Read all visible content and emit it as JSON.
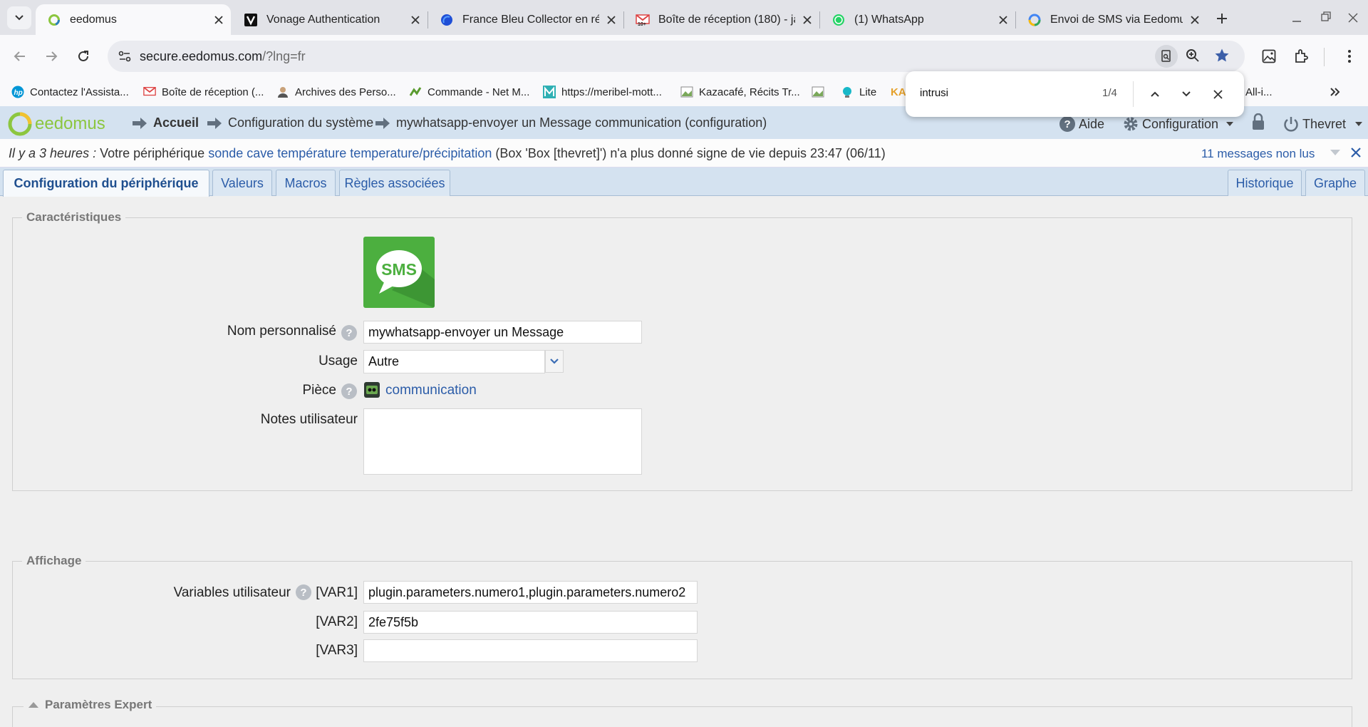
{
  "browser": {
    "tabs": [
      {
        "title": "eedomus",
        "favicon": "eedomus-ring-icon"
      },
      {
        "title": "Vonage Authentication",
        "favicon": "vonage-v-icon"
      },
      {
        "title": "France Bleu Collector en réé",
        "favicon": "france-bleu-icon"
      },
      {
        "title": "Boîte de réception (180) - ja",
        "favicon": "gmail-icon"
      },
      {
        "title": "(1) WhatsApp",
        "favicon": "whatsapp-icon"
      },
      {
        "title": "Envoi de SMS via Eedomus",
        "favicon": "google-icon"
      }
    ],
    "url_host": "secure.eedomus.com",
    "url_path": "/?lng=fr",
    "bookmarks": [
      "Contactez l'Assista...",
      "Boîte de réception (...",
      "Archives des Perso...",
      "Commande - Net M...",
      "https://meribel-mott...",
      "Kazacafé, Récits Tr...",
      "",
      "Lite",
      "KA",
      "All-i..."
    ],
    "find": {
      "query": "intrusi",
      "count": "1/4"
    }
  },
  "header": {
    "logo_text": "eedomus",
    "breadcrumbs": [
      "Accueil",
      "Configuration du système",
      "mywhatsapp-envoyer un Message communication (configuration)"
    ],
    "help_label": "Aide",
    "config_label": "Configuration",
    "user_label": "Thevret"
  },
  "notification": {
    "time": "Il y a 3 heures :",
    "text_before": " Votre périphérique ",
    "device_link": "sonde cave température temperature/précipitation",
    "text_after": " (Box 'Box [thevret]') n'a plus donné signe de vie depuis 23:47 (06/11)",
    "unread": "11 messages non lus"
  },
  "page_tabs": {
    "left": [
      "Configuration du périphérique",
      "Valeurs",
      "Macros",
      "Règles associées"
    ],
    "right": [
      "Historique",
      "Graphe"
    ]
  },
  "caracteristiques": {
    "legend": "Caractéristiques",
    "sms_icon_text": "SMS",
    "nom_label": "Nom personnalisé",
    "nom_value": "mywhatsapp-envoyer un Message",
    "usage_label": "Usage",
    "usage_value": "Autre",
    "piece_label": "Pièce",
    "piece_value": "communication",
    "notes_label": "Notes utilisateur",
    "notes_value": ""
  },
  "affichage": {
    "legend": "Affichage",
    "vars_label": "Variables utilisateur",
    "var1_label": "[VAR1]",
    "var1_value": "plugin.parameters.numero1,plugin.parameters.numero2",
    "var2_label": "[VAR2]",
    "var2_value": "2fe75f5b",
    "var3_label": "[VAR3]",
    "var3_value": ""
  },
  "expert": {
    "legend": "Paramètres Expert"
  },
  "colors": {
    "header_bg": "#d4e2f0",
    "link": "#2b5ca8",
    "sms_green": "#4caf3f",
    "logo_green": "#8cc63f"
  }
}
